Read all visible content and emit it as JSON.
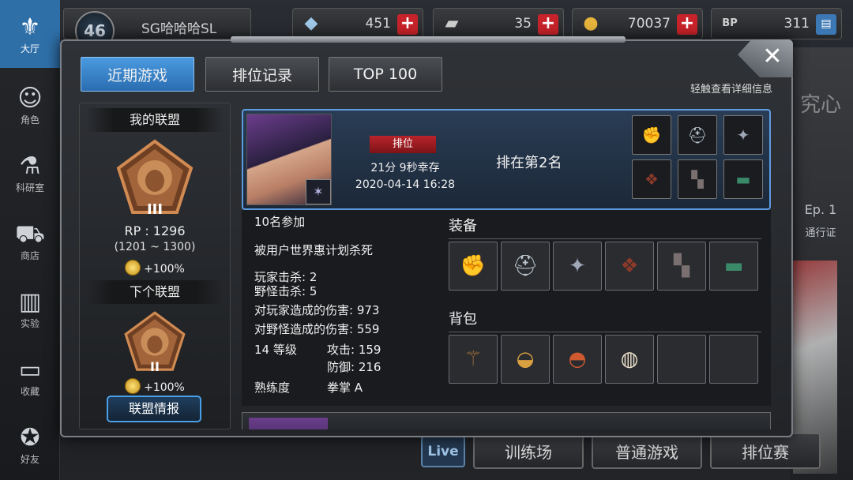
{
  "sidebar": {
    "items": [
      {
        "label": "大厅",
        "icon": "lobby-icon",
        "glyph": "⚜"
      },
      {
        "label": "角色",
        "icon": "character-icon",
        "glyph": "☺"
      },
      {
        "label": "科研室",
        "icon": "lab-flask-icon",
        "glyph": "⚗"
      },
      {
        "label": "商店",
        "icon": "shop-cart-icon",
        "glyph": "⛟"
      },
      {
        "label": "实验",
        "icon": "experiment-icon",
        "glyph": "▥"
      },
      {
        "label": "收藏",
        "icon": "book-icon",
        "glyph": "▭"
      },
      {
        "label": "好友",
        "icon": "gamepad-icon",
        "glyph": "✪"
      }
    ]
  },
  "topbar": {
    "level": "46",
    "player_name": "SG哈哈哈SL",
    "resources": [
      {
        "icon": "crystal-icon",
        "glyph": "◆",
        "value": "451",
        "color": "#9ec8e8"
      },
      {
        "icon": "card-icon",
        "glyph": "▰",
        "value": "35",
        "color": "#cfcfcf"
      },
      {
        "icon": "gold-coin-icon",
        "glyph": "●",
        "value": "70037",
        "color": "#e6b43c"
      },
      {
        "icon": "bp-paw-icon",
        "glyph": "BP",
        "value": "311",
        "color": "#cfcfcf"
      }
    ],
    "plus": "+"
  },
  "modal": {
    "tabs": [
      "近期游戏",
      "排位记录",
      "TOP 100"
    ],
    "close": "✕",
    "hint": "轻触查看详细信息"
  },
  "alliance": {
    "my_title": "我的联盟",
    "my_tier": "III",
    "rp": "RP : 1296",
    "range": "(1201 ~ 1300)",
    "bonus": "+100%",
    "next_title": "下个联盟",
    "next_tier": "II",
    "next_bonus": "+100%",
    "info_button": "联盟情报"
  },
  "match": {
    "mode": "排位",
    "survive": "21分 9秒幸存",
    "date": "2020-04-14 16:28",
    "rank": "排在第2名",
    "participants": "10名参加",
    "killed_by": "被用户世界惠计划杀死",
    "player_kills": "玩家击杀: 2",
    "monster_kills": "野怪击杀: 5",
    "player_damage": "对玩家造成的伤害: 973",
    "monster_damage": "对野怪造成的伤害: 559",
    "level": "14 等级",
    "attack": "攻击: 159",
    "defense": "防御: 216",
    "mastery_label": "熟练度",
    "mastery_value": "拳掌 A",
    "equipment_title": "装备",
    "backpack_title": "背包",
    "equipment": [
      {
        "icon": "red-gauntlet-icon",
        "glyph": "✊",
        "color": "#c23030"
      },
      {
        "icon": "silver-helmet-icon",
        "glyph": "⛑",
        "color": "#b8c4cc"
      },
      {
        "icon": "armor-plate-icon",
        "glyph": "✦",
        "color": "#a0a8b8"
      },
      {
        "icon": "bracer-icon",
        "glyph": "❖",
        "color": "#8a3a2a"
      },
      {
        "icon": "boots-icon",
        "glyph": "▚",
        "color": "#7a7070"
      },
      {
        "icon": "green-accessory-icon",
        "glyph": "▬",
        "color": "#3a8a6a"
      }
    ],
    "backpack": [
      {
        "icon": "branch-material-icon",
        "glyph": "⚚",
        "color": "#9a6a3a"
      },
      {
        "icon": "noodle-bowl-icon",
        "glyph": "◒",
        "color": "#d8a040"
      },
      {
        "icon": "soup-bowl-icon",
        "glyph": "◓",
        "color": "#d05a30"
      },
      {
        "icon": "rice-bowl-icon",
        "glyph": "◍",
        "color": "#e8dcc8"
      },
      {
        "icon": "empty-slot-icon",
        "glyph": "",
        "color": "#2a2c30"
      },
      {
        "icon": "empty-slot-icon",
        "glyph": "",
        "color": "#2a2c30"
      }
    ]
  },
  "background": {
    "deco_top": "究心",
    "deco_ep": "Ep. 1",
    "deco_pass": "通行证",
    "live": "Live",
    "bottom_buttons": [
      "训练场",
      "普通游戏",
      "排位赛"
    ]
  }
}
